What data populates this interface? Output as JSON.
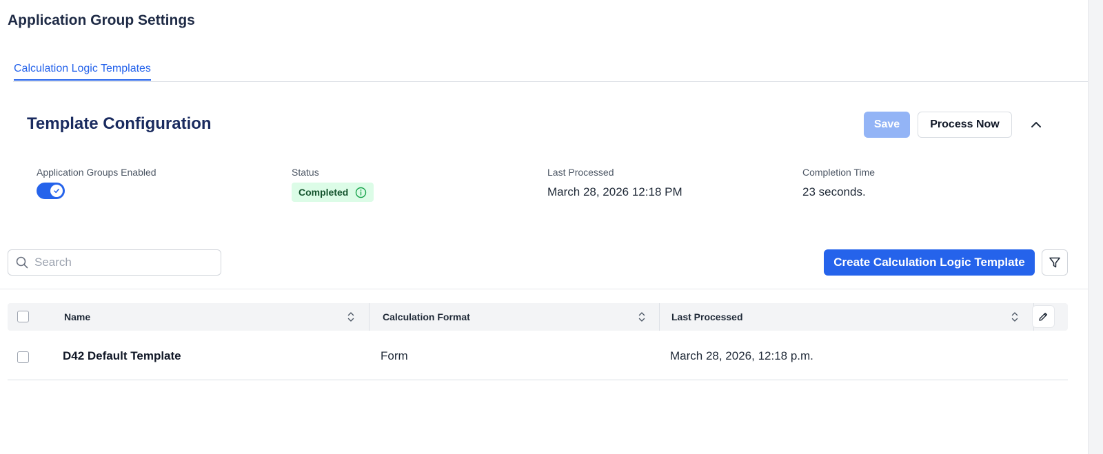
{
  "page": {
    "title": "Application Group Settings"
  },
  "tabs": [
    {
      "label": "Calculation Logic Templates",
      "active": true
    }
  ],
  "config": {
    "title": "Template Configuration",
    "save_label": "Save",
    "process_label": "Process Now",
    "enabled": {
      "label": "Application Groups Enabled",
      "value": true
    },
    "status": {
      "label": "Status",
      "value": "Completed",
      "color": "#dcfce7"
    },
    "last_processed": {
      "label": "Last Processed",
      "value": "March 28, 2026 12:18 PM"
    },
    "completion_time": {
      "label": "Completion Time",
      "value": "23 seconds."
    }
  },
  "toolbar": {
    "search_placeholder": "Search",
    "search_value": "",
    "create_label": "Create Calculation Logic Template"
  },
  "table": {
    "columns": [
      "Name",
      "Calculation Format",
      "Last Processed"
    ],
    "rows": [
      {
        "name": "D42 Default Template",
        "format": "Form",
        "last_processed": "March 28, 2026, 12:18 p.m."
      }
    ]
  },
  "colors": {
    "accent": "#2563eb",
    "accent_disabled": "#93b4f6",
    "heading": "#1a2b5f"
  }
}
